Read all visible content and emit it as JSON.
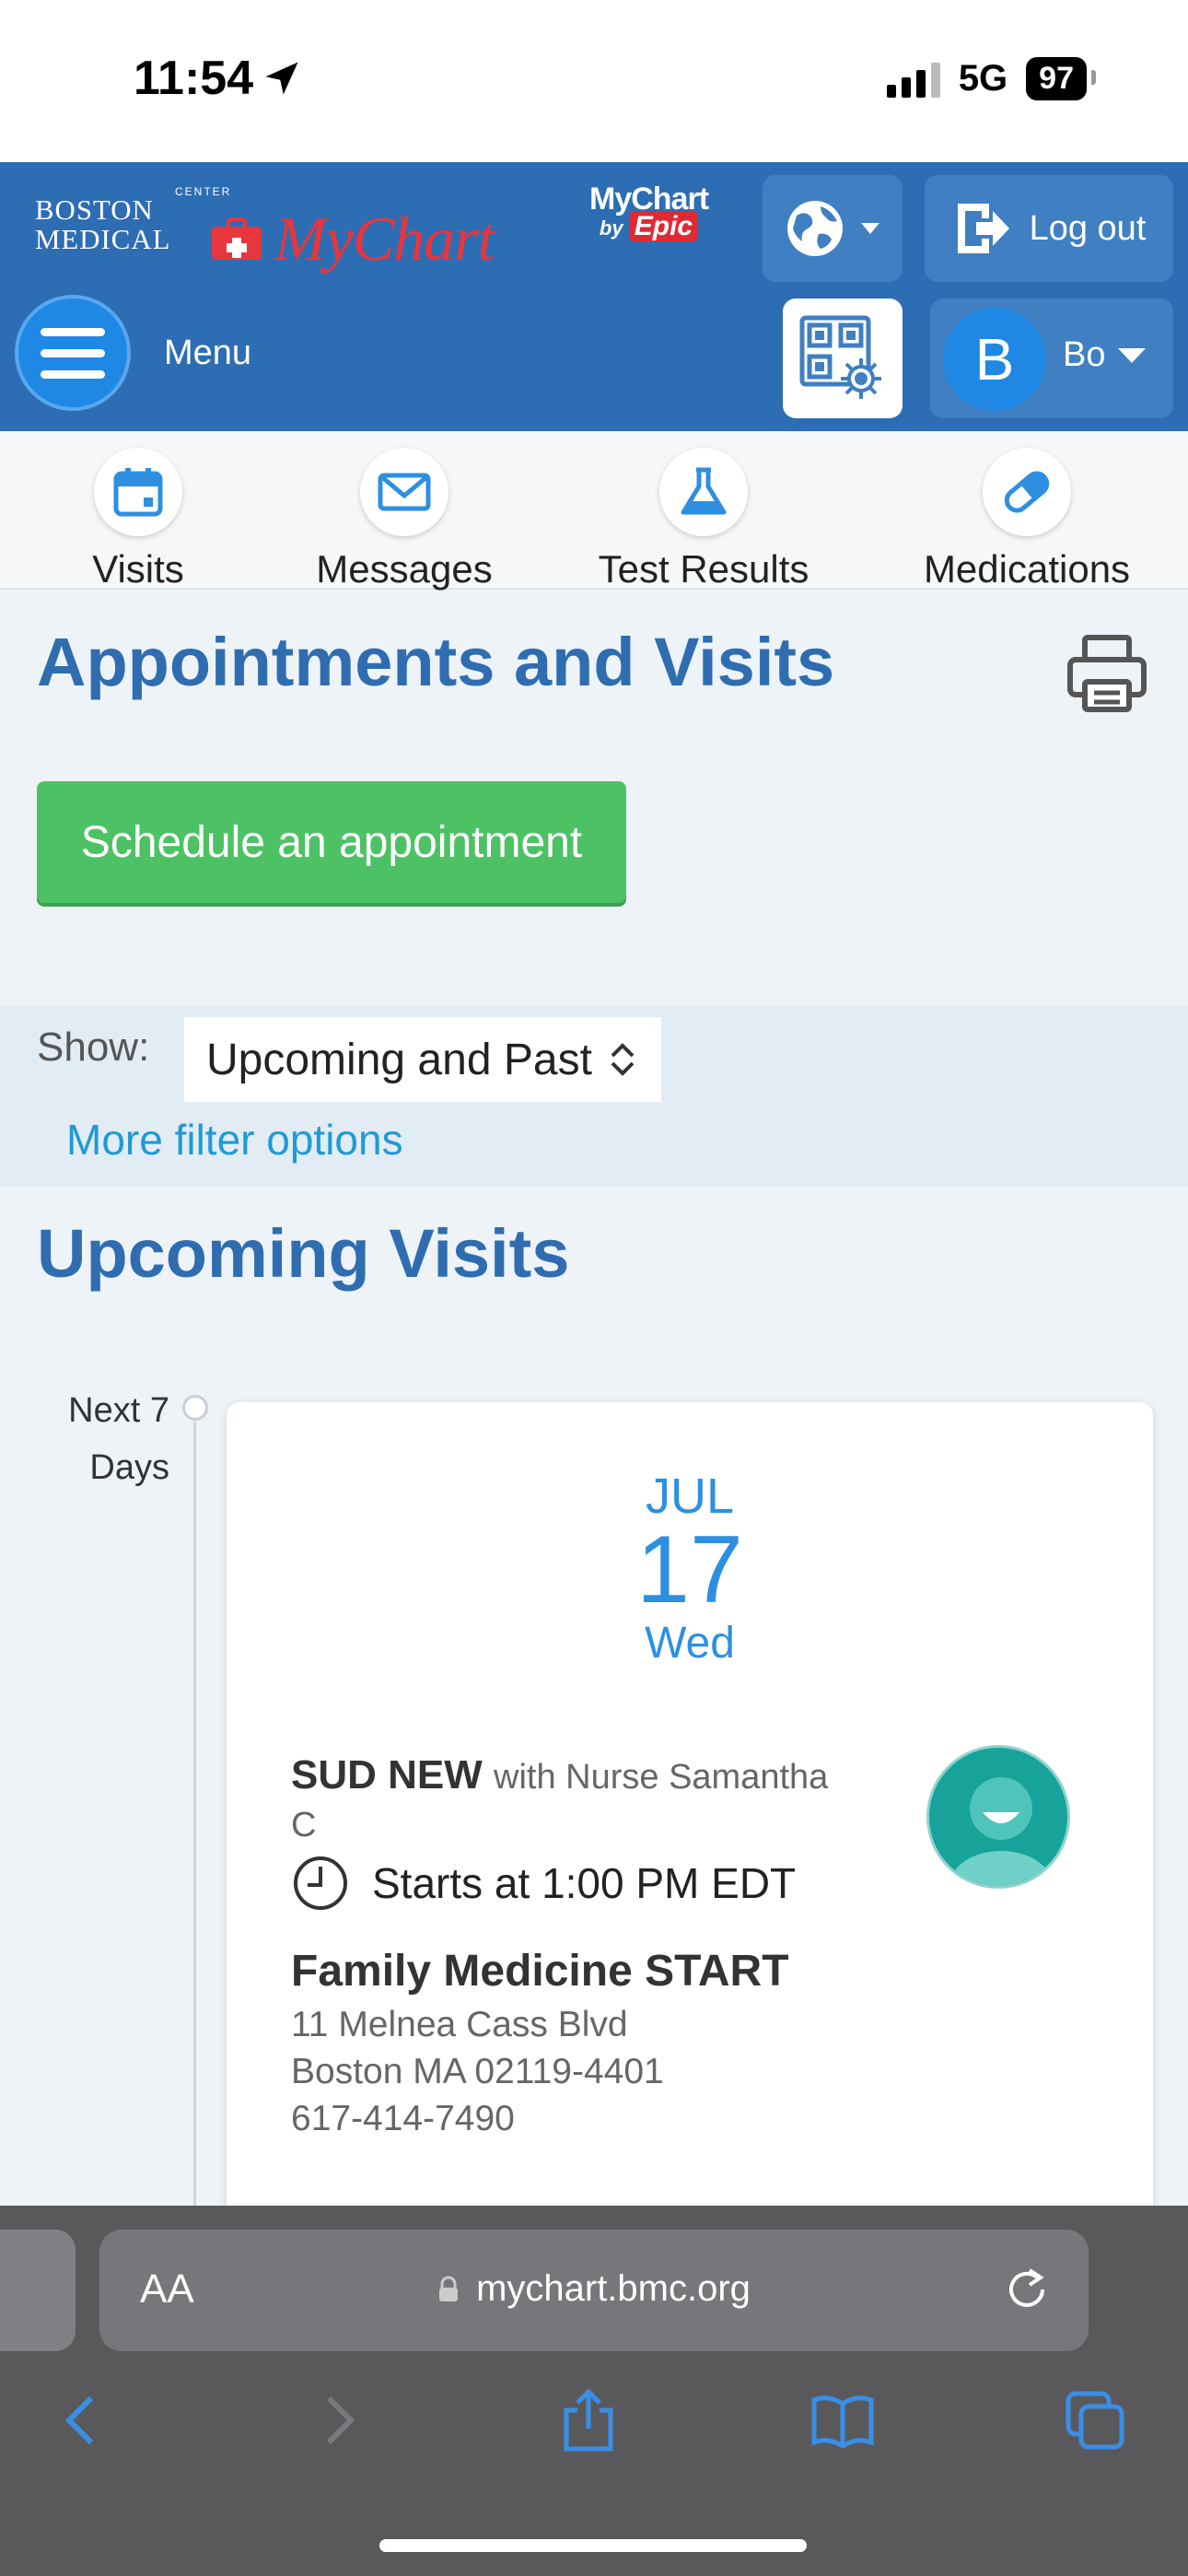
{
  "status_bar": {
    "time": "11:54",
    "network": "5G",
    "battery": "97"
  },
  "header": {
    "logo_top": "BOSTON",
    "logo_bottom": "MEDICAL",
    "logo_center": "CENTER",
    "brand": "MyChart",
    "epic_top": "MyChart",
    "epic_by": "by",
    "epic_word": "Epic",
    "logout_label": "Log out",
    "menu_label": "Menu",
    "user_initial": "B",
    "user_name": "Bo"
  },
  "quick_nav": [
    {
      "label": "Visits",
      "icon": "calendar-icon"
    },
    {
      "label": "Messages",
      "icon": "envelope-icon"
    },
    {
      "label": "Test Results",
      "icon": "flask-icon"
    },
    {
      "label": "Medications",
      "icon": "pill-icon"
    }
  ],
  "main": {
    "page_title": "Appointments and Visits",
    "schedule_button": "Schedule an appointment",
    "show_label": "Show:",
    "show_value": "Upcoming and Past",
    "more_filters": "More filter options",
    "section_title": "Upcoming Visits",
    "timeline_label": "Next 7 Days"
  },
  "visit": {
    "month": "JUL",
    "day": "17",
    "weekday": "Wed",
    "type": "SUD NEW",
    "provider": "with Nurse Samantha C",
    "time": "Starts at 1:00 PM EDT",
    "location": "Family Medicine START",
    "address_line1": "11 Melnea Cass Blvd",
    "address_line2": "Boston MA 02119-4401",
    "phone": "617-414-7490"
  },
  "browser": {
    "aa": "AA",
    "url": "mychart.bmc.org"
  },
  "colors": {
    "header_blue": "#2d6db3",
    "title_blue": "#2f6db0",
    "schedule_green": "#4cc264",
    "link_blue": "#1f9ad6",
    "date_blue": "#2e8fe0"
  }
}
